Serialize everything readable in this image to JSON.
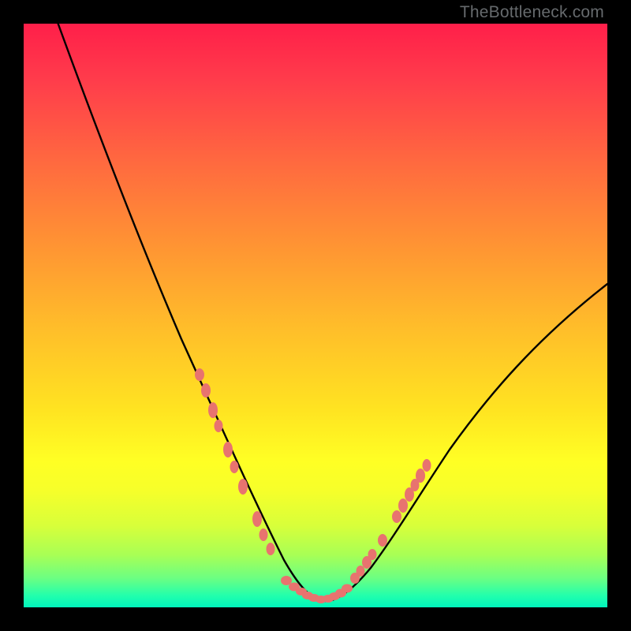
{
  "watermark": "TheBottleneck.com",
  "colors": {
    "background": "#000000",
    "gradient_top": "#ff1f4a",
    "gradient_bottom": "#00f5bc",
    "curve": "#000000",
    "beads": "#e8736f"
  },
  "chart_data": {
    "type": "line",
    "title": "",
    "xlabel": "",
    "ylabel": "",
    "xlim": [
      0,
      100
    ],
    "ylim": [
      0,
      100
    ],
    "grid": false,
    "legend": false,
    "series": [
      {
        "name": "bottleneck_curve",
        "x": [
          5,
          10,
          15,
          20,
          25,
          30,
          35,
          40,
          43,
          46,
          48,
          50,
          52,
          55,
          58,
          62,
          67,
          72,
          78,
          85,
          92,
          100
        ],
        "y": [
          100,
          88,
          76,
          64,
          52,
          40,
          28,
          17,
          10,
          5,
          2,
          1,
          1,
          2,
          4,
          8,
          14,
          21,
          29,
          38,
          47,
          55
        ]
      }
    ],
    "markers": [
      {
        "name": "left_cluster",
        "points_xy": [
          [
            30,
            40
          ],
          [
            31,
            37
          ],
          [
            32.5,
            33
          ],
          [
            33,
            31
          ],
          [
            35,
            26
          ],
          [
            36,
            23
          ],
          [
            37.5,
            20
          ],
          [
            40,
            14
          ],
          [
            41,
            12
          ],
          [
            42,
            10
          ]
        ]
      },
      {
        "name": "bottom_cluster",
        "points_xy": [
          [
            45,
            3.5
          ],
          [
            46,
            2.8
          ],
          [
            47,
            2.2
          ],
          [
            48,
            1.6
          ],
          [
            49,
            1.3
          ],
          [
            50,
            1.1
          ],
          [
            51,
            1.2
          ],
          [
            52,
            1.5
          ],
          [
            53,
            2.0
          ],
          [
            54,
            2.6
          ]
        ]
      },
      {
        "name": "right_lower_cluster",
        "points_xy": [
          [
            56,
            4.2
          ],
          [
            57,
            5.2
          ],
          [
            58,
            6.0
          ],
          [
            59,
            7.0
          ],
          [
            61,
            9.5
          ]
        ]
      },
      {
        "name": "right_upper_cluster",
        "points_xy": [
          [
            63,
            12.5
          ],
          [
            64,
            14.5
          ],
          [
            65,
            16.4
          ],
          [
            66,
            18.0
          ],
          [
            67,
            19.8
          ],
          [
            68,
            21.5
          ]
        ]
      }
    ]
  }
}
